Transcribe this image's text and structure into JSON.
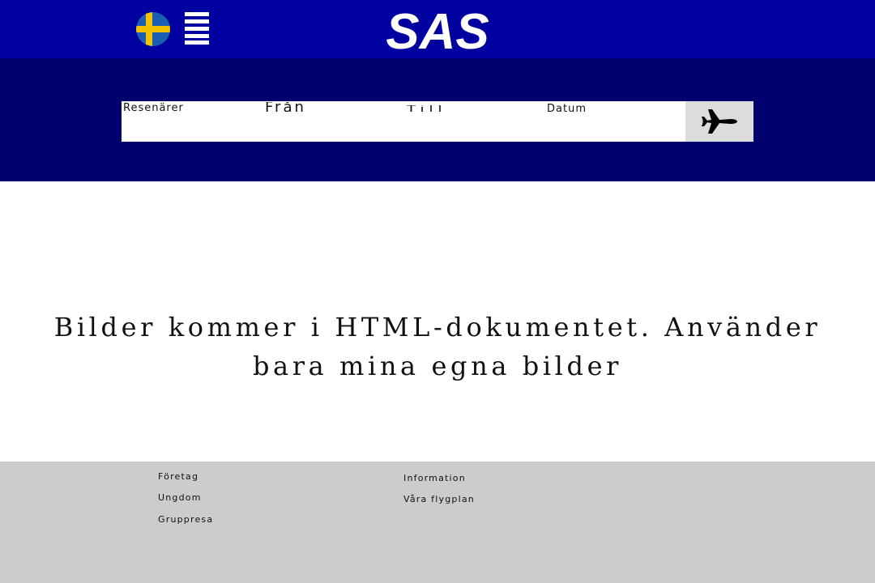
{
  "header": {
    "flag_icon": "sweden-flag-icon",
    "menu_icon": "hamburger-menu-icon",
    "logo_text": "SAS",
    "colors": {
      "top_bar": "#0000a0",
      "booking_band": "#00006e",
      "logo": "#ffffff"
    }
  },
  "search": {
    "travelers_label": "Resenärer",
    "from_label": "Från",
    "to_label": "Till",
    "date_label": "Datum",
    "submit_icon": "airplane-icon",
    "colors": {
      "bar": "#ffffff",
      "button": "#dcdcdc"
    }
  },
  "main": {
    "message": "Bilder kommer i HTML-dokumentet. Använder bara mina egna bilder"
  },
  "footer": {
    "left_links": [
      "Företag",
      "Ungdom",
      "Gruppresa"
    ],
    "right_links": [
      "Information",
      "Våra flygplan"
    ],
    "colors": {
      "background": "#cccccc"
    }
  }
}
